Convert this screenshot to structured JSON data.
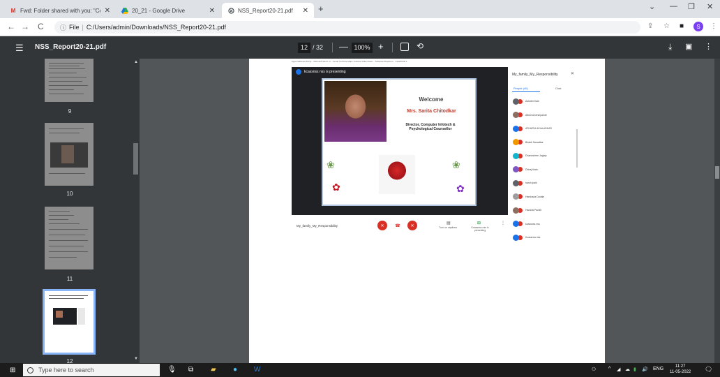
{
  "tabs": [
    {
      "title": "Fwd: Folder shared with you: \"Co",
      "icon": "gmail-icon",
      "active": false
    },
    {
      "title": "20_21 - Google Drive",
      "icon": "drive-icon",
      "active": false
    },
    {
      "title": "NSS_Report20-21.pdf",
      "icon": "globe-icon",
      "active": true
    }
  ],
  "address": {
    "scheme_label": "File",
    "url": "C:/Users/admin/Downloads/NSS_Report20-21.pdf",
    "profile_initial": "S"
  },
  "pdf_toolbar": {
    "doc_title": "NSS_Report20-21.pdf",
    "current_page": "12",
    "total_pages": "/ 32",
    "zoom": "100%"
  },
  "sidebar": {
    "page_labels": [
      "9",
      "10",
      "11",
      "12"
    ],
    "selected": "12"
  },
  "meet_capture": {
    "bookmarks": "Apps   National (2073)...   Microsoft Word - F...   Gmail   YouTube   Maps   Youtube Video Down...   Software Requirem...   CHAPTER 1",
    "presenting_label": "kcassnss nss is presenting",
    "slide": {
      "welcome": "Welcome",
      "name": "Mrs. Sarita Chitodkar",
      "role_line1": "Director, Computer Infotech &",
      "role_line2": "Psychological Counsellor"
    },
    "meeting_title": "My_family_My_Responsibility",
    "captions_label": "Turn on captions",
    "presenting_short": "Kcassnss nss is presenting",
    "panel_title": "My_family_My_Responsibility",
    "people_tab": "People (40)",
    "chat_tab": "Chat",
    "participants": [
      {
        "name": "Ashwini Kale",
        "color": "#5f6368"
      },
      {
        "name": "Atharva Deshpande",
        "color": "#8d6e63"
      },
      {
        "name": "ATHARVA KHALADKAR",
        "color": "#1a73e8"
      },
      {
        "name": "Bhakti Sanadkar",
        "color": "#f29900"
      },
      {
        "name": "Dhanashree Jagtap",
        "color": "#12b5cb"
      },
      {
        "name": "Dhiraj Kadu",
        "color": "#7e57c2"
      },
      {
        "name": "harsh joshi",
        "color": "#5f6368"
      },
      {
        "name": "Harshada Dodale",
        "color": "#9e9e9e"
      },
      {
        "name": "Harshal Pandit",
        "color": "#8d6e63"
      },
      {
        "name": "kcassnss nss",
        "color": "#1a73e8"
      },
      {
        "name": "Kcassnss nss",
        "color": "#1a73e8"
      }
    ]
  },
  "taskbar": {
    "search_placeholder": "Type here to search",
    "lang": "ENG",
    "time": "11:27",
    "date": "11-05-2022"
  }
}
